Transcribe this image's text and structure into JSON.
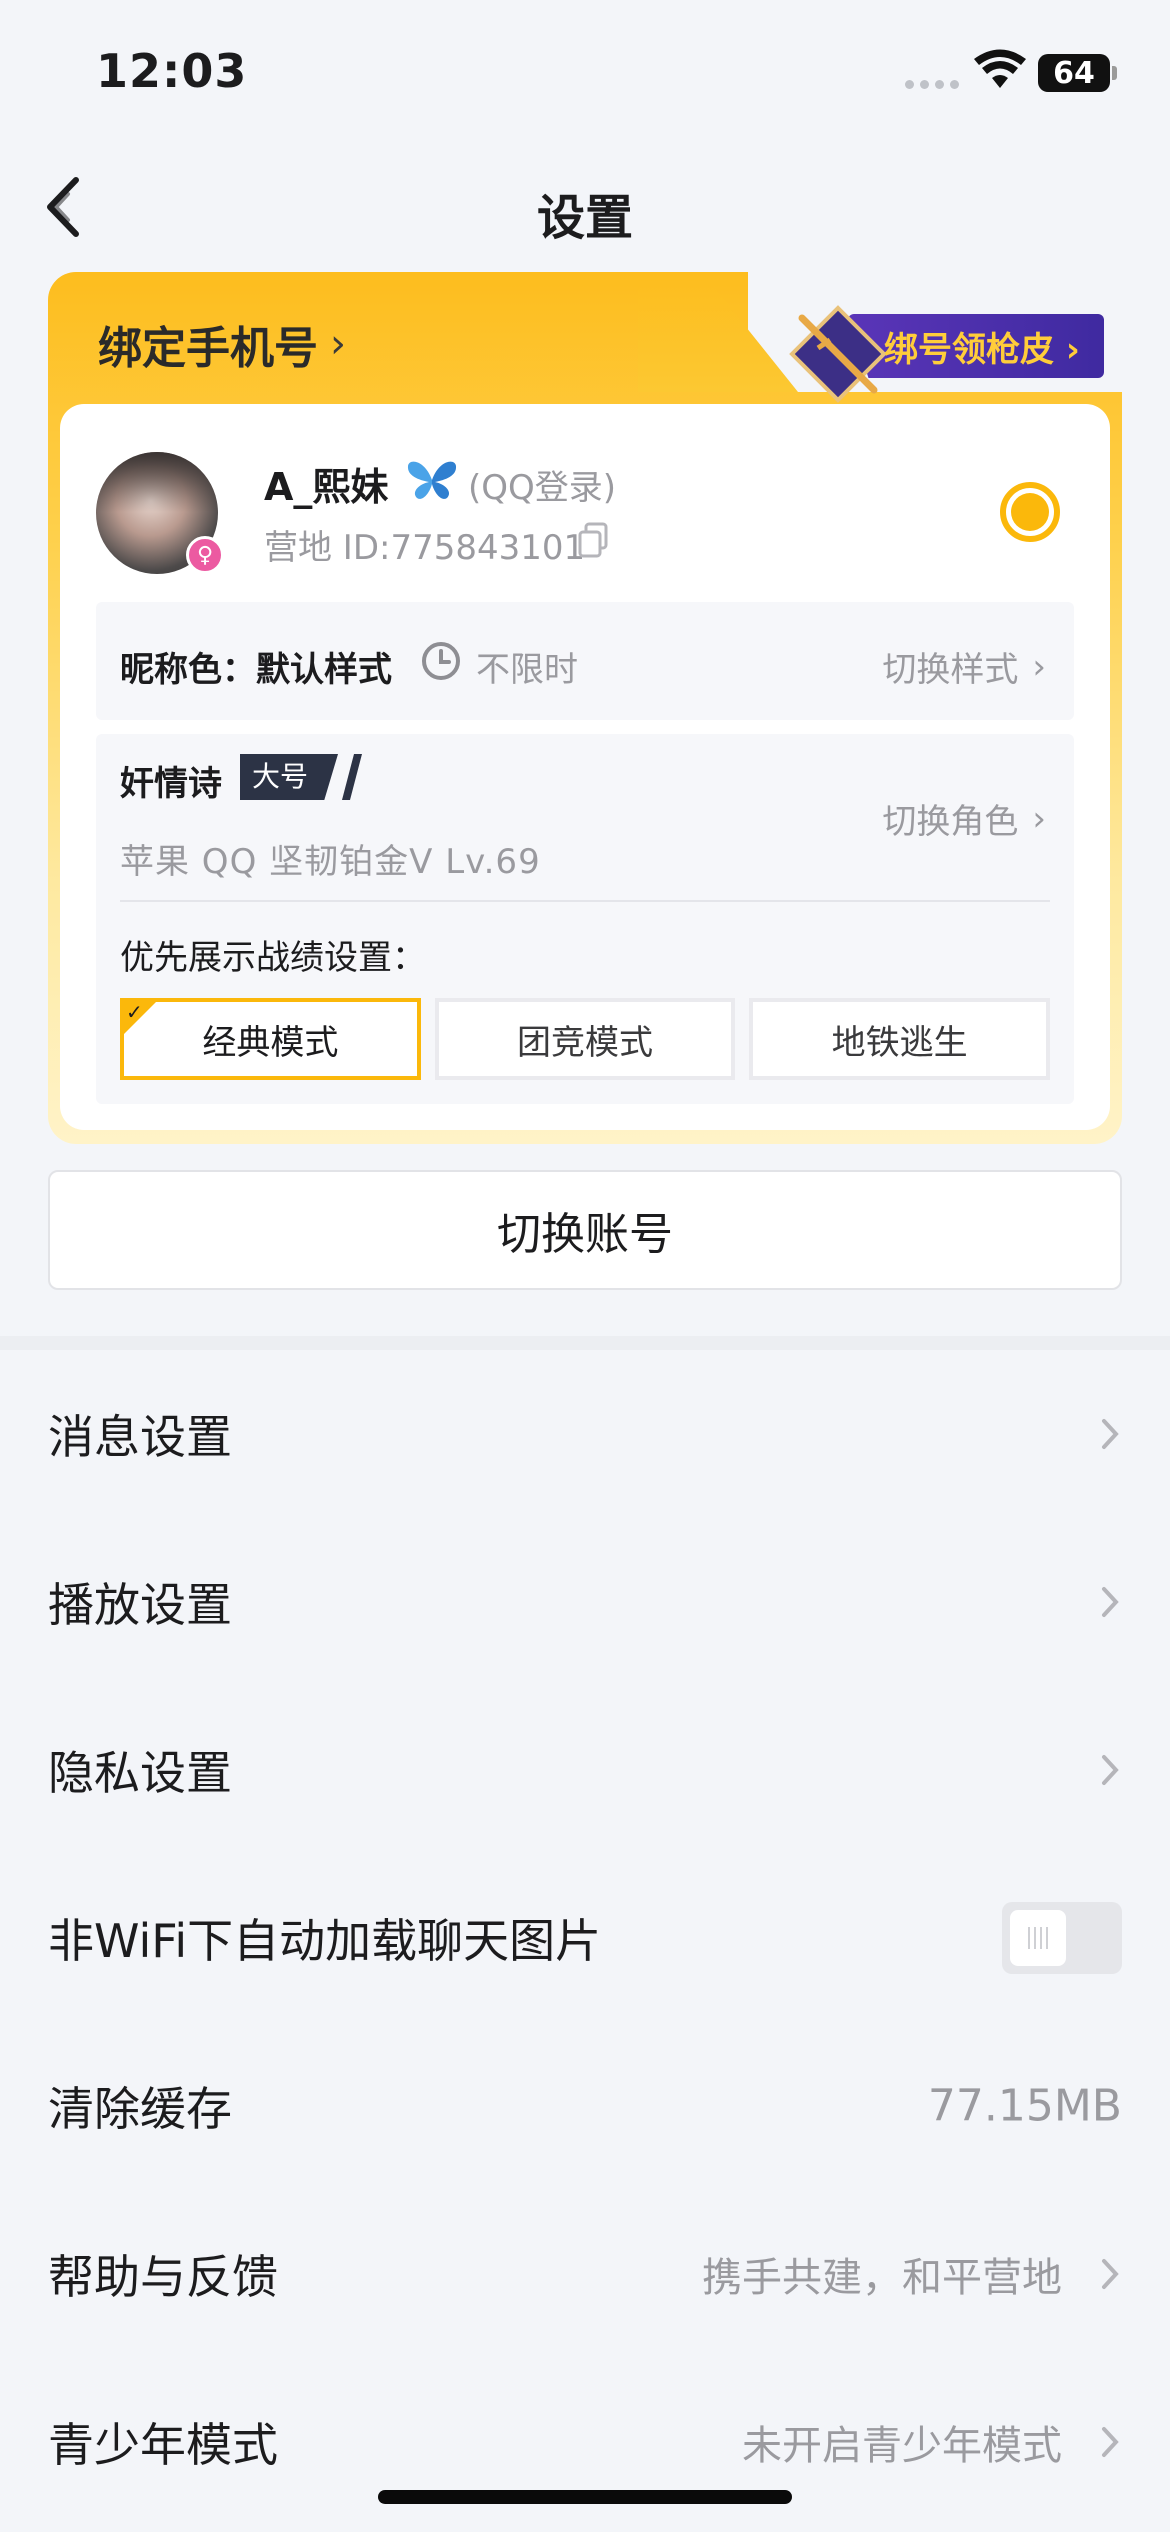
{
  "status_bar": {
    "time": "12:03",
    "battery": "64"
  },
  "nav": {
    "title": "设置"
  },
  "account_card": {
    "bind_phone_label": "绑定手机号",
    "promo_label": "绑号领枪皮",
    "username": "A_熙妹",
    "login_type": "(QQ登录)",
    "camp_id": "营地 ID:775843101",
    "nickname_color_label": "昵称色：默认样式",
    "nickname_limit": "不限时",
    "switch_style": "切换样式",
    "role_name": "奸情诗",
    "role_tag": "大号",
    "role_detail": "苹果 QQ  坚韧铂金Ⅴ  Lv.69",
    "switch_role": "切换角色",
    "record_label": "优先展示战绩设置：",
    "modes": [
      "经典模式",
      "团竞模式",
      "地铁逃生"
    ],
    "active_mode": "经典模式"
  },
  "switch_account_label": "切换账号",
  "settings": [
    {
      "label": "消息设置"
    },
    {
      "label": "播放设置"
    },
    {
      "label": "隐私设置"
    },
    {
      "label": "非WiFi下自动加载聊天图片",
      "toggle": false
    },
    {
      "label": "清除缓存",
      "value": "77.15MB"
    },
    {
      "label": "帮助与反馈",
      "value": "携手共建，和平营地"
    },
    {
      "label": "青少年模式",
      "value": "未开启青少年模式"
    }
  ],
  "colors": {
    "accent": "#fbb80b",
    "background": "#f3f5f9",
    "muted_text": "#9a9a9f"
  }
}
